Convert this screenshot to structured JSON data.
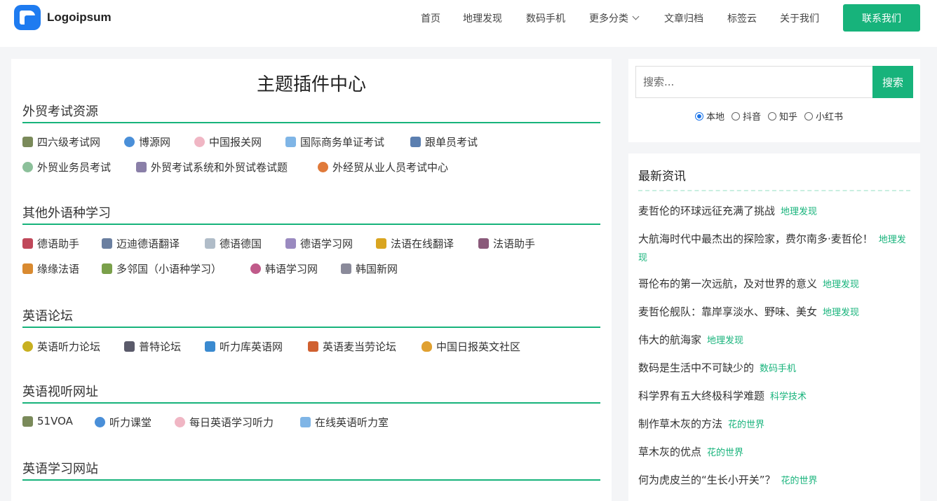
{
  "header": {
    "logo_text": "Logoipsum",
    "nav": [
      "首页",
      "地理发现",
      "数码手机",
      "更多分类",
      "文章归档",
      "标签云",
      "关于我们"
    ],
    "contact_label": "联系我们"
  },
  "main": {
    "title": "主题插件中心",
    "sections": [
      {
        "title": "外贸考试资源",
        "links": [
          {
            "label": "四六级考试网",
            "icon": "building-icon"
          },
          {
            "label": "博源网",
            "icon": "globe-icon"
          },
          {
            "label": "中国报关网",
            "icon": "search-badge-icon"
          },
          {
            "label": "国际商务单证考试",
            "icon": "people-icon"
          },
          {
            "label": "跟单员考试",
            "icon": "document-icon"
          },
          {
            "label": "外贸业务员考试",
            "icon": "badge-icon"
          },
          {
            "label": "外贸考试系统和外贸试卷试题",
            "icon": "keyboard-icon"
          },
          {
            "label": "外经贸从业人员考试中心",
            "icon": "medal-icon"
          }
        ]
      },
      {
        "title": "其他外语种学习",
        "links": [
          {
            "label": "德语助手",
            "icon": "flag-icon"
          },
          {
            "label": "迈迪德语翻译",
            "icon": "chart-icon"
          },
          {
            "label": "德语德国",
            "icon": "page-icon"
          },
          {
            "label": "德语学习网",
            "icon": "pencil-page-icon"
          },
          {
            "label": "法语在线翻译",
            "icon": "edit-icon"
          },
          {
            "label": "法语助手",
            "icon": "window-icon"
          },
          {
            "label": "缘缘法语",
            "icon": "window-icon"
          },
          {
            "label": "多邻国（小语种学习）",
            "icon": "window-icon"
          },
          {
            "label": "韩语学习网",
            "icon": "pin-icon"
          },
          {
            "label": "韩国新网",
            "icon": "calendar-icon"
          }
        ]
      },
      {
        "title": "英语论坛",
        "links": [
          {
            "label": "英语听力论坛",
            "icon": "pencil-circle-icon"
          },
          {
            "label": "普特论坛",
            "icon": "notebook-icon"
          },
          {
            "label": "听力库英语网",
            "icon": "monitor-icon"
          },
          {
            "label": "英语麦当劳论坛",
            "icon": "star-window-icon"
          },
          {
            "label": "中国日报英文社区",
            "icon": "bulb-icon"
          }
        ]
      },
      {
        "title": "英语视听网址",
        "links": [
          {
            "label": "51VOA",
            "icon": "building-icon"
          },
          {
            "label": "听力课堂",
            "icon": "globe-icon"
          },
          {
            "label": "每日英语学习听力",
            "icon": "search-badge-icon"
          },
          {
            "label": "在线英语听力室",
            "icon": "people-icon"
          }
        ]
      },
      {
        "title": "英语学习网站",
        "links": []
      }
    ]
  },
  "search": {
    "placeholder": "搜索...",
    "button_label": "搜索",
    "options": [
      "本地",
      "抖音",
      "知乎",
      "小红书"
    ],
    "selected": "本地"
  },
  "news": {
    "title": "最新资讯",
    "items": [
      {
        "text": "麦哲伦的环球远征充满了挑战",
        "tag": "地理发现"
      },
      {
        "text": "大航海时代中最杰出的探险家，费尔南多·麦哲伦！",
        "tag": "地理发现"
      },
      {
        "text": "哥伦布的第一次远航，及对世界的意义",
        "tag": "地理发现"
      },
      {
        "text": "麦哲伦舰队：靠岸享淡水、野味、美女",
        "tag": "地理发现"
      },
      {
        "text": "伟大的航海家",
        "tag": "地理发现"
      },
      {
        "text": "数码是生活中不可缺少的",
        "tag": "数码手机"
      },
      {
        "text": "科学界有五大终极科学难题",
        "tag": "科学技术"
      },
      {
        "text": "制作草木灰的方法",
        "tag": "花的世界"
      },
      {
        "text": "草木灰的优点",
        "tag": "花的世界"
      },
      {
        "text": "何为虎皮兰的“生长小开关”？",
        "tag": "花的世界"
      }
    ]
  },
  "colors": {
    "accent": "#17b37b",
    "logo_blue": "#1e7bf0",
    "page_bg": "#f4f5f7"
  }
}
